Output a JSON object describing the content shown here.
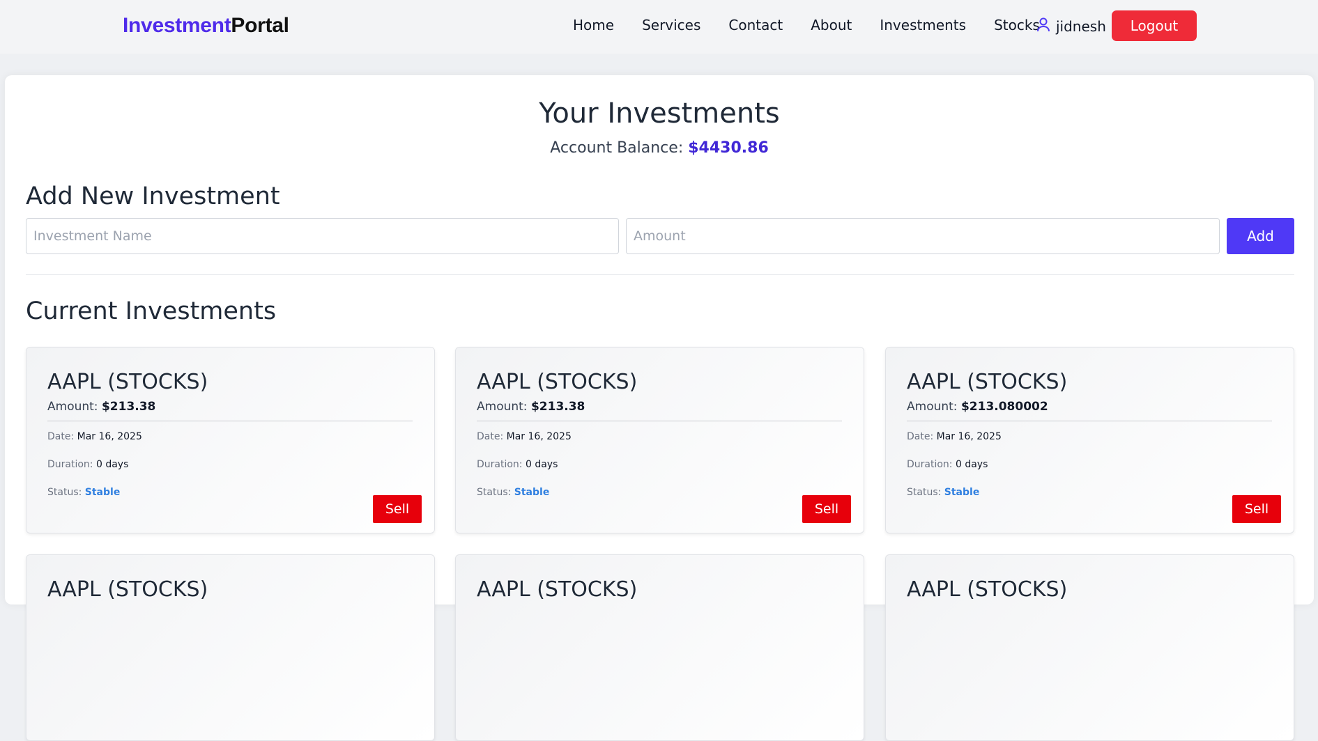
{
  "brand": {
    "part1": "Investment",
    "part2": "Portal",
    "accent_color": "#4f2bea"
  },
  "nav": {
    "links": [
      "Home",
      "Services",
      "Contact",
      "About",
      "Investments",
      "Stocks"
    ],
    "user_icon": "user-icon",
    "username": "jidnesh",
    "logout_label": "Logout",
    "logout_color": "#ef2b38"
  },
  "main": {
    "title": "Your Investments",
    "balance_label": "Account Balance:",
    "balance_value": "$4430.86"
  },
  "add_form": {
    "heading": "Add New Investment",
    "name_placeholder": "Investment Name",
    "amount_placeholder": "Amount",
    "add_label": "Add",
    "add_color": "#4f39f6"
  },
  "current": {
    "heading": "Current Investments",
    "labels": {
      "amount": "Amount:",
      "date": "Date:",
      "duration": "Duration:",
      "status": "Status:",
      "sell": "Sell"
    },
    "cards": [
      {
        "title": "AAPL (STOCKS)",
        "amount": "$213.38",
        "date": "Mar 16, 2025",
        "duration": "0 days",
        "status": "Stable"
      },
      {
        "title": "AAPL (STOCKS)",
        "amount": "$213.38",
        "date": "Mar 16, 2025",
        "duration": "0 days",
        "status": "Stable"
      },
      {
        "title": "AAPL (STOCKS)",
        "amount": "$213.080002",
        "date": "Mar 16, 2025",
        "duration": "0 days",
        "status": "Stable"
      },
      {
        "title": "AAPL (STOCKS)"
      },
      {
        "title": "AAPL (STOCKS)"
      },
      {
        "title": "AAPL (STOCKS)"
      }
    ]
  }
}
